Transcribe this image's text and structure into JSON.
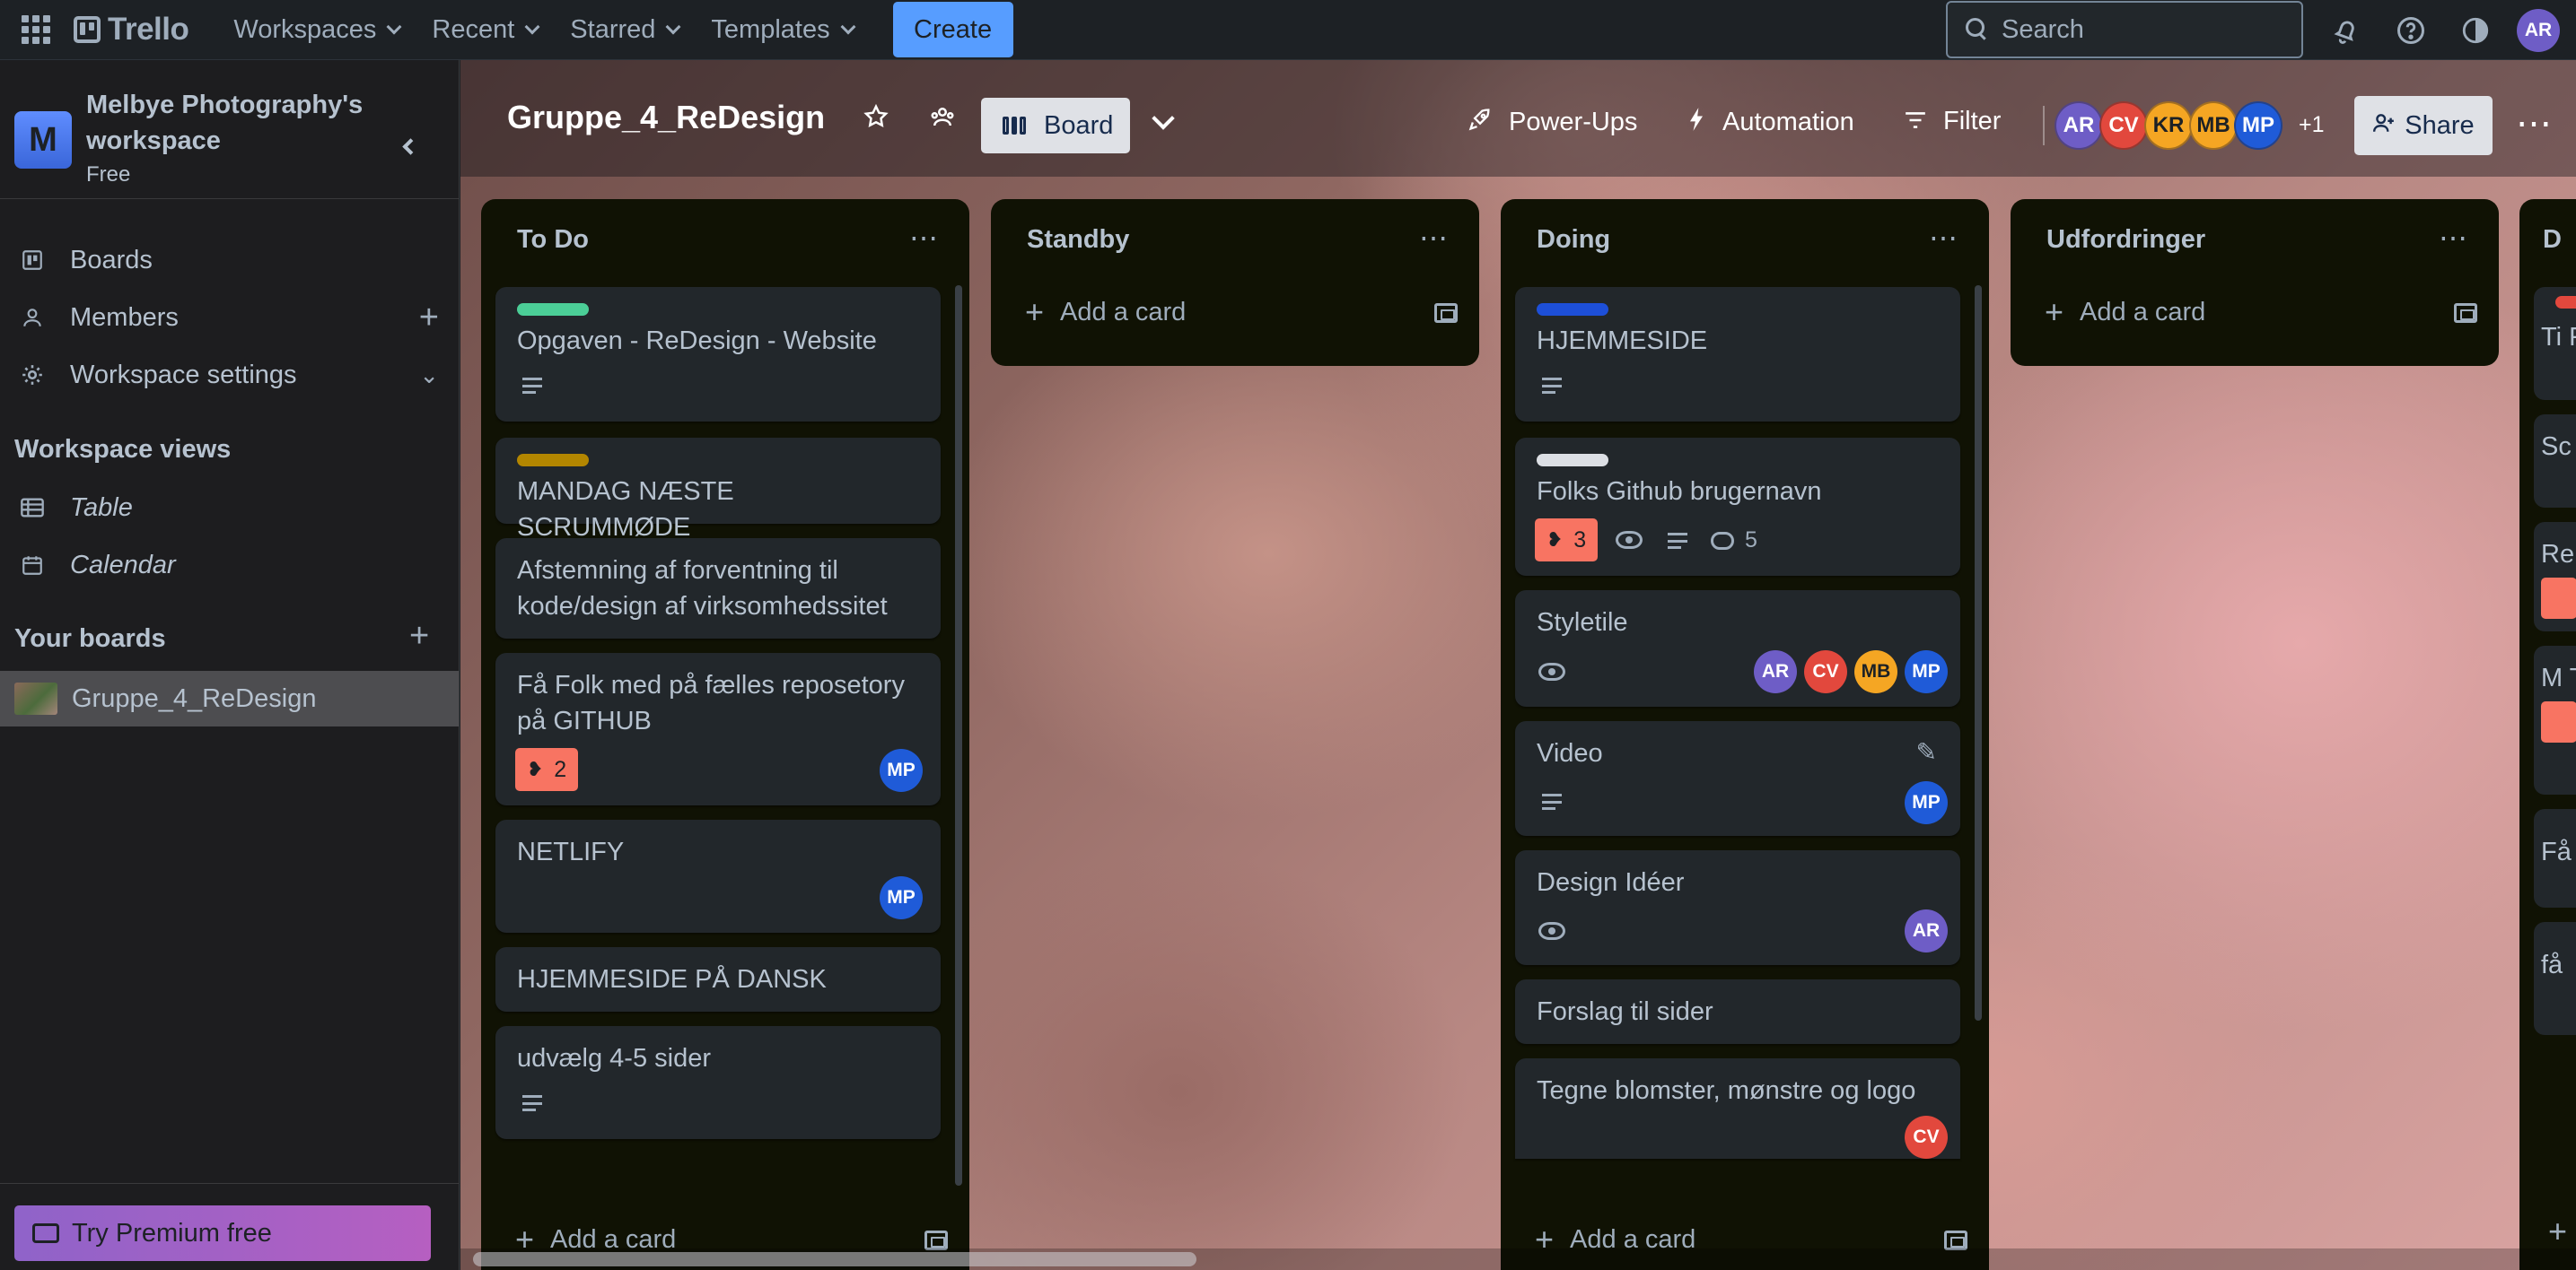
{
  "topbar": {
    "logo": "Trello",
    "nav": [
      "Workspaces",
      "Recent",
      "Starred",
      "Templates"
    ],
    "create_label": "Create",
    "search_placeholder": "Search",
    "user_initials": "AR"
  },
  "sidebar": {
    "workspace_name": "Melbye Photography's workspace",
    "workspace_initial": "M",
    "workspace_plan": "Free",
    "items": [
      {
        "label": "Boards",
        "icon": "trello-board-icon"
      },
      {
        "label": "Members",
        "icon": "person-icon"
      },
      {
        "label": "Workspace settings",
        "icon": "gear-icon"
      }
    ],
    "views_heading": "Workspace views",
    "views": [
      {
        "label": "Table",
        "icon": "table-icon"
      },
      {
        "label": "Calendar",
        "icon": "calendar-icon"
      }
    ],
    "boards_heading": "Your boards",
    "boards": [
      {
        "label": "Gruppe_4_ReDesign"
      }
    ],
    "premium_label": "Try Premium free"
  },
  "board": {
    "title": "Gruppe_4_ReDesign",
    "view_label": "Board",
    "powerups_label": "Power-Ups",
    "automation_label": "Automation",
    "filter_label": "Filter",
    "members": [
      "AR",
      "CV",
      "KR",
      "MB",
      "MP"
    ],
    "more_members": "+1",
    "share_label": "Share",
    "add_card_label": "Add a card"
  },
  "lists": [
    {
      "title": "To Do",
      "cards": [
        {
          "title": "Opgaven - ReDesign - Website",
          "label_color": "#4bce97"
        },
        {
          "title": "MANDAG NÆSTE SCRUMMØDE",
          "label_color": "#b38600"
        },
        {
          "title": "Afstemning af forventning til kode/design af virksomhedssitet"
        },
        {
          "title": "Få Folk med på fælles reposetory på GITHUB",
          "votes": "2",
          "member": "MP"
        },
        {
          "title": "NETLIFY",
          "member": "MP"
        },
        {
          "title": "HJEMMESIDE PÅ DANSK"
        },
        {
          "title": "udvælg 4-5 sider"
        }
      ]
    },
    {
      "title": "Standby",
      "cards": []
    },
    {
      "title": "Doing",
      "cards": [
        {
          "title": "HJEMMESIDE",
          "label_color": "#1d4fd8"
        },
        {
          "title": "Folks Github brugernavn",
          "label_color": "#dcdfe4",
          "votes": "3",
          "comments": "5"
        },
        {
          "title": "Styletile",
          "members": [
            "AR",
            "CV",
            "MB",
            "MP"
          ]
        },
        {
          "title": "Video",
          "member": "MP"
        },
        {
          "title": "Design Idéer",
          "member": "AR"
        },
        {
          "title": "Forslag til sider"
        },
        {
          "title": "Tegne blomster, mønstre og logo",
          "member": "CV"
        }
      ]
    },
    {
      "title": "Udfordringer",
      "cards": []
    },
    {
      "title": "D",
      "cards": [
        {
          "title": "Ti Fl"
        },
        {
          "title": "Sc"
        },
        {
          "title": "Re"
        },
        {
          "title": "M Tl"
        },
        {
          "title": "Få"
        },
        {
          "title": "få"
        }
      ]
    }
  ],
  "colors": {
    "accent": "#579dff",
    "list_bg": "#101204",
    "card_bg": "#22272b",
    "vote_badge": "#f87462"
  }
}
